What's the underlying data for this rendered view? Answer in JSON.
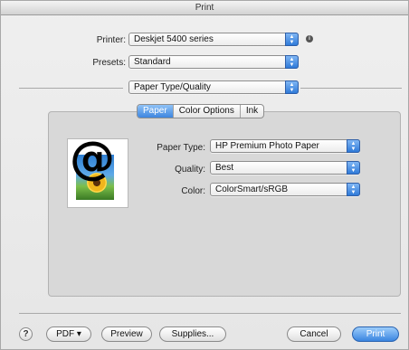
{
  "window": {
    "title": "Print"
  },
  "printer": {
    "label": "Printer:",
    "value": "Deskjet 5400 series"
  },
  "presets": {
    "label": "Presets:",
    "value": "Standard"
  },
  "section": {
    "value": "Paper Type/Quality"
  },
  "tabs": [
    {
      "label": "Paper",
      "active": true
    },
    {
      "label": "Color Options",
      "active": false
    },
    {
      "label": "Ink",
      "active": false
    }
  ],
  "paper_type": {
    "label": "Paper Type:",
    "value": "HP Premium Photo Paper"
  },
  "quality": {
    "label": "Quality:",
    "value": "Best"
  },
  "color": {
    "label": "Color:",
    "value": "ColorSmart/sRGB"
  },
  "preview_glyph": "@",
  "buttons": {
    "help": "?",
    "pdf": "PDF ▾",
    "preview": "Preview",
    "supplies": "Supplies...",
    "cancel": "Cancel",
    "print": "Print"
  },
  "colors": {
    "accent": "#3d86df"
  },
  "icons": [
    "info-icon",
    "popup-arrows-icon",
    "help-icon",
    "photo-thumbnail"
  ]
}
